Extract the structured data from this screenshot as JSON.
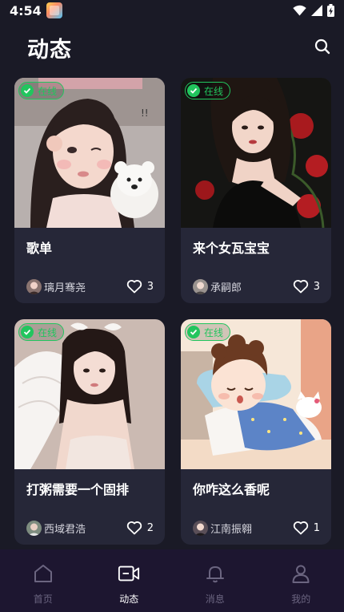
{
  "status_bar": {
    "time": "4:54"
  },
  "header": {
    "title": "动态"
  },
  "posts": [
    {
      "title": "歌单",
      "author": "璃月骞尧",
      "likes": "3",
      "online": "在线"
    },
    {
      "title": "来个女瓦宝宝",
      "author": "承嗣郎",
      "likes": "3",
      "online": "在线"
    },
    {
      "title": "打粥需要一个固排",
      "author": "西域君浩",
      "likes": "2",
      "online": "在线"
    },
    {
      "title": "你咋这么香呢",
      "author": "江南振翱",
      "likes": "1",
      "online": "在线"
    }
  ],
  "nav": [
    {
      "label": "首页",
      "icon": "home-icon"
    },
    {
      "label": "动态",
      "icon": "video-icon",
      "active": true
    },
    {
      "label": "消息",
      "icon": "bell-icon"
    },
    {
      "label": "我的",
      "icon": "user-icon"
    }
  ],
  "colors": {
    "background": "#1a1a26",
    "card": "#262738",
    "online": "#22c55e",
    "nav_bg": "#1d1630",
    "nav_inactive": "#6b6580"
  }
}
